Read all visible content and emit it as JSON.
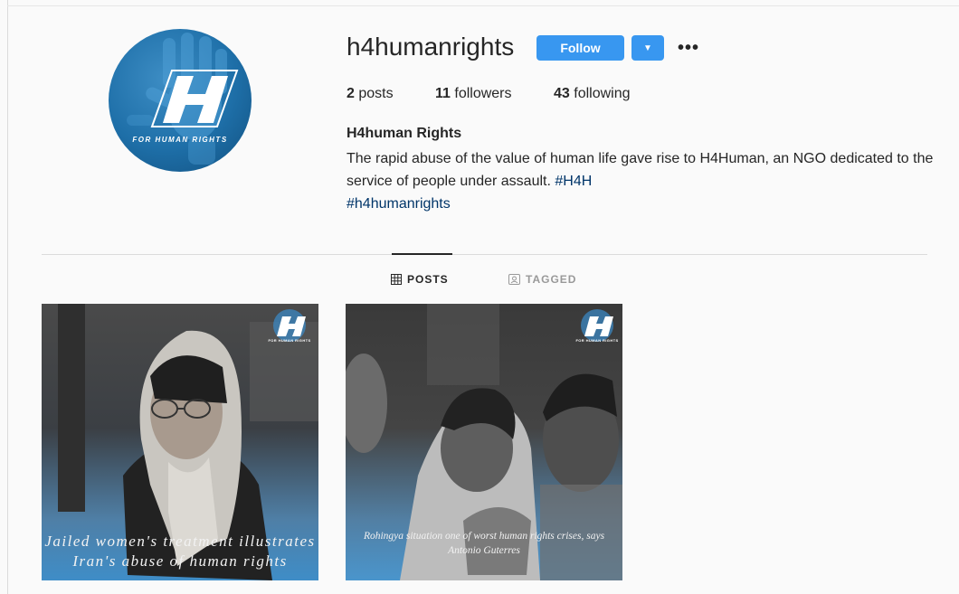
{
  "profile": {
    "username": "h4humanrights",
    "follow_label": "Follow",
    "avatar_logo_letter": "H",
    "avatar_logo_sub": "FOR HUMAN RIGHTS",
    "stats": {
      "posts_count": "2",
      "posts_label": "posts",
      "followers_count": "11",
      "followers_label": "followers",
      "following_count": "43",
      "following_label": "following"
    },
    "full_name": "H4human Rights",
    "bio_text": "The rapid abuse of the value of human life gave rise to H4Human, an NGO dedicated to the service of people under assault. ",
    "bio_tags": [
      "#H4H",
      "#h4humanrights"
    ]
  },
  "tabs": [
    {
      "label": "POSTS",
      "icon": "grid-icon",
      "active": true
    },
    {
      "label": "TAGGED",
      "icon": "tagged-icon",
      "active": false
    }
  ],
  "posts": [
    {
      "caption_line1": "Jailed women's treatment illustrates",
      "caption_line2": "Iran's abuse of  human rights",
      "logo_text": "FOR HUMAN RIGHTS"
    },
    {
      "caption_line1": "Rohingya  situation  one  of   worst human rights crises, says",
      "caption_line2": "Antonio  Guterres",
      "logo_text": "FOR HUMAN RIGHTS"
    }
  ],
  "colors": {
    "accent": "#3897f0",
    "link": "#003569",
    "text": "#262626",
    "muted": "#999999",
    "logo_blue": "#1e6fa8"
  }
}
